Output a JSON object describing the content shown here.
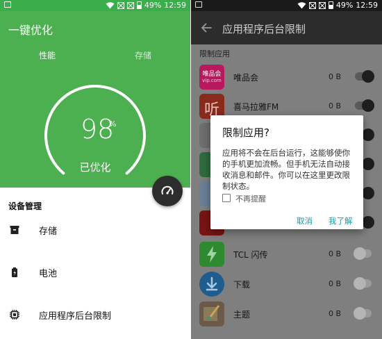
{
  "status_bar": {
    "battery_text": "49%",
    "time": "12:59"
  },
  "left": {
    "title": "一键优化",
    "tabs": [
      {
        "label": "性能",
        "active": true
      },
      {
        "label": "存储",
        "active": false
      }
    ],
    "score": "98",
    "score_unit": "%",
    "score_label": "已优化",
    "section_header": "设备管理",
    "items": [
      {
        "label": "存储",
        "icon": "archive-icon"
      },
      {
        "label": "电池",
        "icon": "battery-icon"
      },
      {
        "label": "应用程序后台限制",
        "icon": "chip-icon"
      }
    ],
    "accent_color": "#4caf50"
  },
  "right": {
    "title": "应用程序后台限制",
    "section_label": "限制应用",
    "apps": [
      {
        "name": "唯品会",
        "size": "0 B",
        "enabled": true,
        "icon": "vipshop-icon",
        "icon_text": "唯品会",
        "icon_sub": "vip.com"
      },
      {
        "name": "喜马拉雅FM",
        "size": "0 B",
        "enabled": true,
        "icon": "ximalaya-icon",
        "icon_text": "听"
      },
      {
        "name": "",
        "size": "",
        "enabled": true,
        "icon": "app-icon"
      },
      {
        "name": "",
        "size": "",
        "enabled": true,
        "icon": "app-icon"
      },
      {
        "name": "",
        "size": "",
        "enabled": true,
        "icon": "app-icon"
      },
      {
        "name": "",
        "size": "",
        "enabled": true,
        "icon": "app-icon"
      },
      {
        "name": "TCL 闪传",
        "size": "0 B",
        "enabled": false,
        "icon": "flash-icon"
      },
      {
        "name": "下载",
        "size": "0 B",
        "enabled": false,
        "icon": "download-icon"
      },
      {
        "name": "主题",
        "size": "0 B",
        "enabled": false,
        "icon": "theme-icon"
      }
    ]
  },
  "dialog": {
    "title": "限制应用?",
    "body": "应用将不会在后台运行，这能够使你的手机更加流畅。但手机无法自动接收消息和邮件。你可以在这里更改限制状态。",
    "checkbox_label": "不再提醒",
    "cancel_label": "取消",
    "ok_label": "我了解",
    "accent_color": "#1f9aa1"
  }
}
